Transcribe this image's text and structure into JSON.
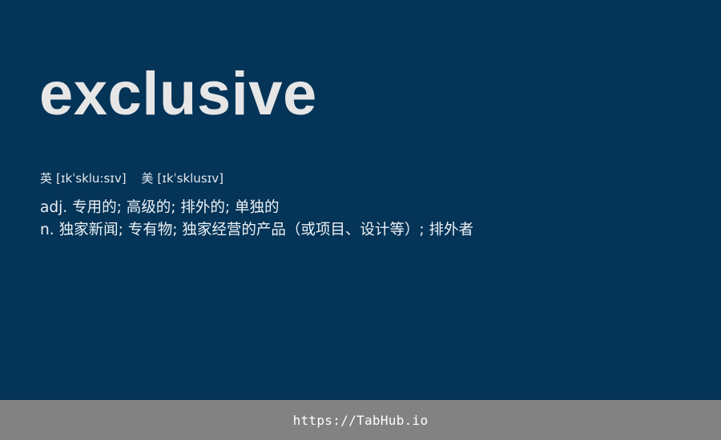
{
  "card": {
    "word": "exclusive",
    "phonetics": [
      {
        "label": "英",
        "ipa": "[ɪkˈsklu:sɪv]"
      },
      {
        "label": "美",
        "ipa": "[ɪkˈsklusɪv]"
      }
    ],
    "definitions": [
      {
        "pos": "adj.",
        "meaning": "专用的; 高级的; 排外的; 单独的"
      },
      {
        "pos": "n.",
        "meaning": "独家新闻; 专有物; 独家经营的产品（或项目、设计等）; 排外者"
      }
    ]
  },
  "footer": {
    "link": "https://TabHub.io"
  },
  "colors": {
    "background": "#043457",
    "word": "#e6e6e6",
    "footer_background": "#828282"
  }
}
